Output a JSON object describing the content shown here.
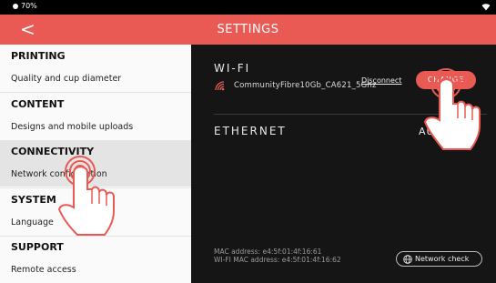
{
  "status_bar": {
    "battery_text": "70%"
  },
  "header": {
    "back_glyph": "<",
    "title": "SETTINGS"
  },
  "sidebar": {
    "sections": [
      {
        "heading": "PRINTING",
        "item": "Quality and cup diameter"
      },
      {
        "heading": "CONTENT",
        "item": "Designs and mobile uploads"
      },
      {
        "heading": "CONNECTIVITY",
        "item": "Network configuration"
      },
      {
        "heading": "SYSTEM",
        "item": "Language"
      },
      {
        "heading": "SUPPORT",
        "item": "Remote access"
      }
    ],
    "active_section": "CONNECTIVITY"
  },
  "main": {
    "wifi": {
      "label": "WI-FI",
      "network_name": "CommunityFibre10Gb_CA621_5Ghz",
      "disconnect_label": "Disconnect",
      "change_label": "CHANGE"
    },
    "ethernet": {
      "label": "ETHERNET",
      "mode_label": "AUTO"
    },
    "mac_address": "MAC address: e4:5f:01:4f:16:61",
    "wifi_mac_address": "WI-FI MAC address: e4:5f:01:4f:16:62",
    "network_check_label": "Network check"
  },
  "colors": {
    "accent": "#ea5a55",
    "panel_dark": "#151515",
    "sidebar_bg": "#fafafa",
    "active_item_bg": "#e4e4e4"
  },
  "icons": [
    "wifi-icon",
    "battery-icon",
    "back-chevron-icon",
    "wifi-signal-icon",
    "globe-icon",
    "tap-hand-icon"
  ]
}
